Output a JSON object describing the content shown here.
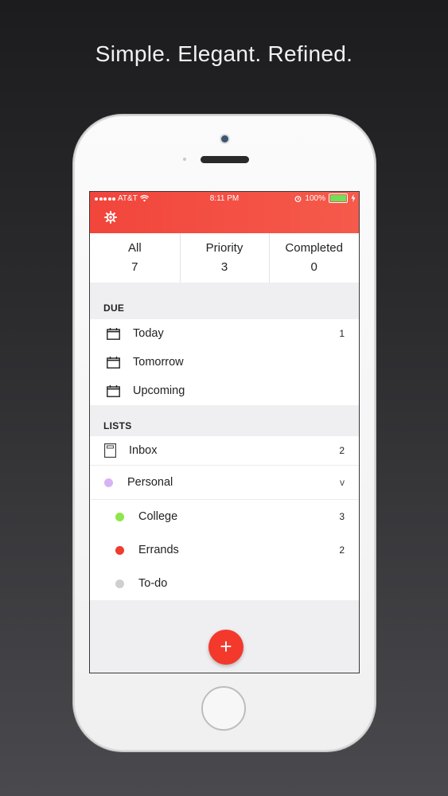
{
  "tagline": "Simple. Elegant. Refined.",
  "status_bar": {
    "carrier": "AT&T",
    "time": "8:11 PM",
    "battery": "100%",
    "battery_level": 1.0
  },
  "stats": [
    {
      "label": "All",
      "count": "7"
    },
    {
      "label": "Priority",
      "count": "3"
    },
    {
      "label": "Completed",
      "count": "0"
    }
  ],
  "due": {
    "title": "DUE",
    "items": [
      {
        "label": "Today",
        "count": "1"
      },
      {
        "label": "Tomorrow",
        "count": ""
      },
      {
        "label": "Upcoming",
        "count": ""
      }
    ]
  },
  "lists": {
    "title": "LISTS",
    "inbox": {
      "label": "Inbox",
      "count": "2"
    },
    "group": {
      "label": "Personal",
      "chevron": "v",
      "color": "#d6b4f3"
    },
    "children": [
      {
        "label": "College",
        "count": "3",
        "color": "#8ee64a"
      },
      {
        "label": "Errands",
        "count": "2",
        "color": "#ef3c2e"
      },
      {
        "label": "To-do",
        "count": "",
        "color": "#cfcfcf"
      }
    ]
  },
  "fab": {
    "label": "+"
  },
  "colors": {
    "accent": "#f2453b",
    "background": "#efeff2"
  },
  "icons": [
    "gear-icon",
    "calendar-icon",
    "inbox-icon",
    "wifi-icon",
    "alarm-icon",
    "charging-icon",
    "battery-icon"
  ]
}
